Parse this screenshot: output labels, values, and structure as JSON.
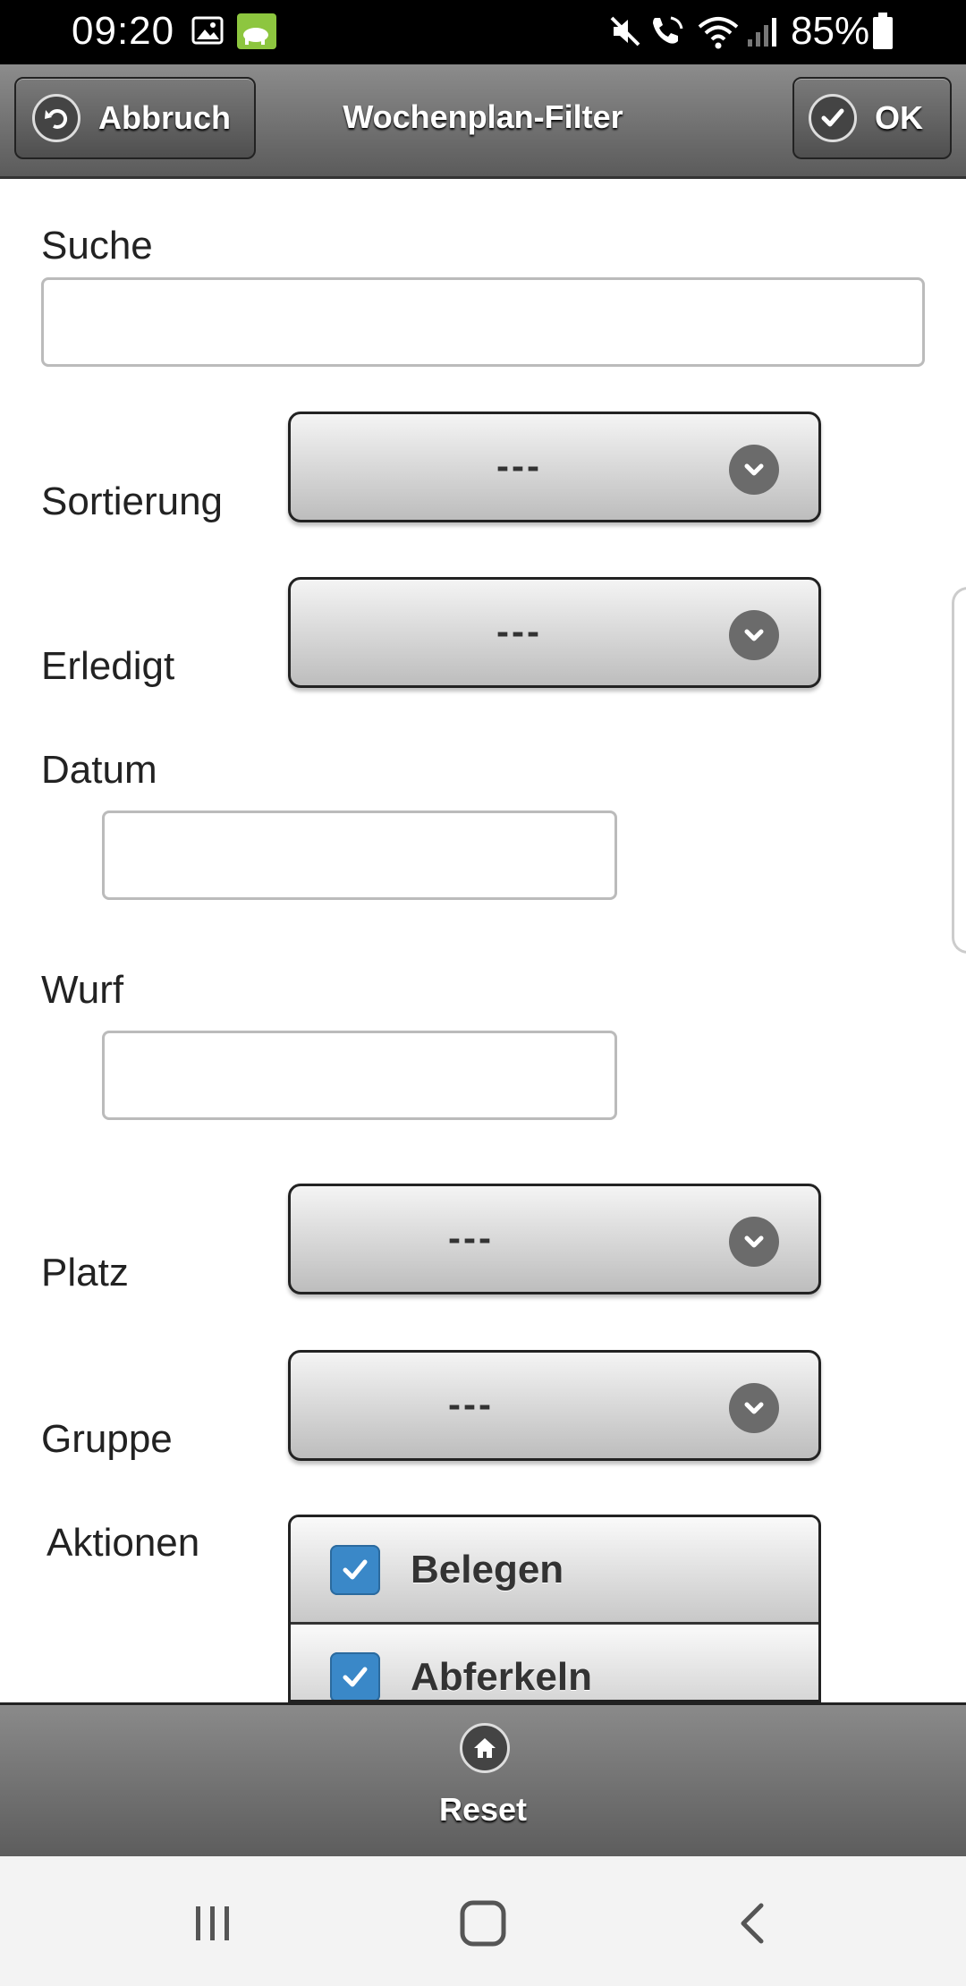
{
  "status_bar": {
    "time": "09:20",
    "battery": "85%",
    "icons": [
      "gallery-icon",
      "app-notification-icon",
      "mute-icon",
      "wifi-call-icon",
      "wifi-icon",
      "signal-icon",
      "battery-icon"
    ]
  },
  "header": {
    "title": "Wochenplan-Filter",
    "cancel_label": "Abbruch",
    "ok_label": "OK"
  },
  "form": {
    "search": {
      "label": "Suche",
      "value": ""
    },
    "sort": {
      "label": "Sortierung",
      "selected": "---"
    },
    "done": {
      "label": "Erledigt",
      "selected": "---"
    },
    "date": {
      "label": "Datum",
      "value": ""
    },
    "litter": {
      "label": "Wurf",
      "value": ""
    },
    "place": {
      "label": "Platz",
      "selected": "---"
    },
    "group": {
      "label": "Gruppe",
      "selected": "---"
    },
    "actions": {
      "label": "Aktionen",
      "items": [
        {
          "label": "Belegen",
          "checked": true
        },
        {
          "label": "Abferkeln",
          "checked": true
        }
      ]
    }
  },
  "footer": {
    "reset_label": "Reset"
  },
  "colors": {
    "checkbox": "#3a88c8",
    "header_top": "#8c8c8c",
    "header_bottom": "#5b5b5b"
  }
}
